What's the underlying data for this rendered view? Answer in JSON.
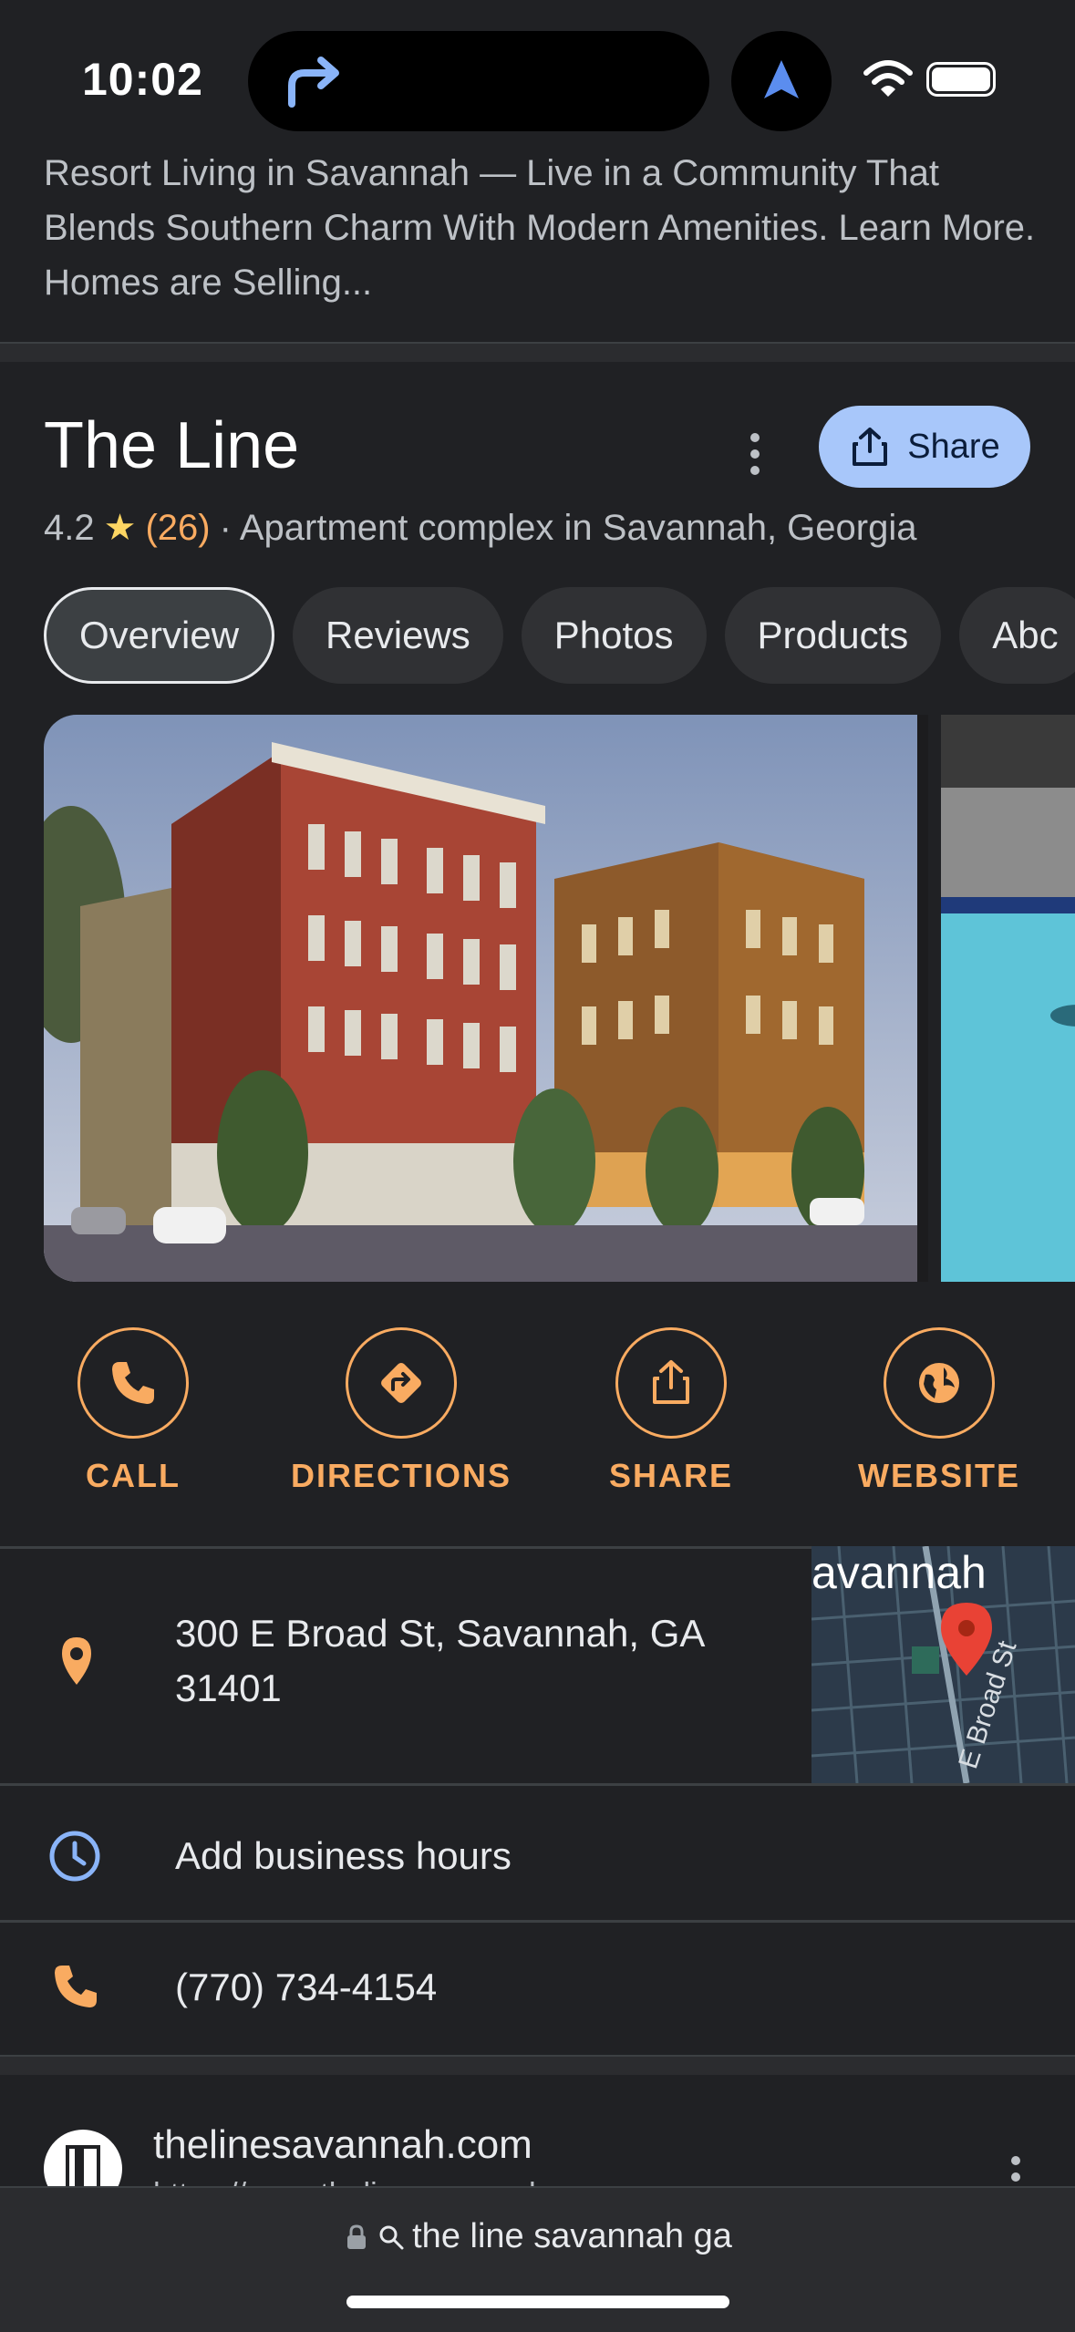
{
  "status_bar": {
    "time": "10:02"
  },
  "ad": {
    "snippet": "Resort Living in Savannah — Live in a Community That Blends Southern Charm With Modern Amenities. Learn More. Homes are Selling..."
  },
  "place": {
    "title": "The Line",
    "share_label": "Share",
    "rating": "4.2",
    "review_count": "(26)",
    "category": "· Apartment complex in Savannah, Georgia"
  },
  "tabs": [
    {
      "label": "Overview",
      "active": true
    },
    {
      "label": "Reviews"
    },
    {
      "label": "Photos"
    },
    {
      "label": "Products"
    },
    {
      "label": "Abc"
    }
  ],
  "actions": {
    "call": "CALL",
    "directions": "DIRECTIONS",
    "share": "SHARE",
    "website": "WEBSITE"
  },
  "info": {
    "address_line1": "300 E Broad St, Savannah, GA",
    "address_line2": "31401",
    "hours": "Add business hours",
    "phone": "(770) 734-4154",
    "map_label": "avannah",
    "map_street": "E Broad St"
  },
  "website": {
    "name": "thelinesavannah.com",
    "url": "https://www.thelinesavannah..."
  },
  "browser": {
    "query": "the line savannah ga"
  },
  "colors": {
    "accent": "#f9ab61",
    "share_button": "#a8c7fa",
    "star": "#fdd663",
    "clock_icon": "#8ab4f8"
  }
}
